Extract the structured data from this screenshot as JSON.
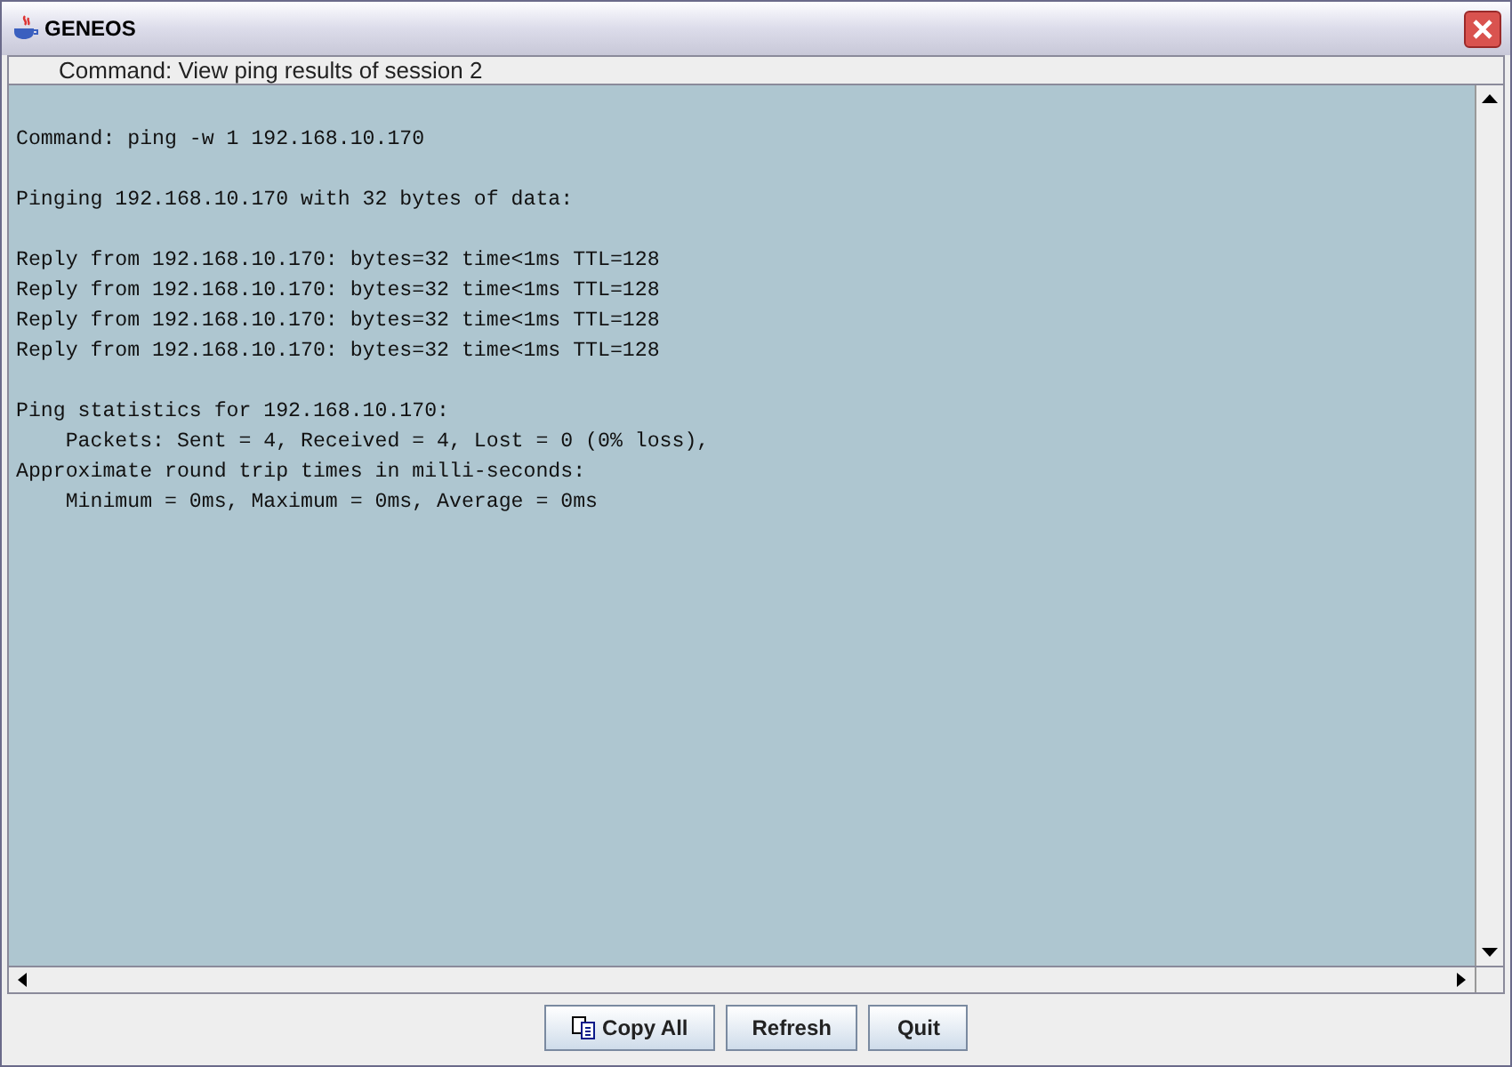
{
  "window": {
    "title": "GENEOS"
  },
  "header": "Command: View ping results of session 2",
  "output": [
    [
      "Command: ping -w 1 192.168.10.170"
    ],
    [
      "Pinging 192.168.10.170 with 32 bytes of data:"
    ],
    [
      "Reply from 192.168.10.170: bytes=32 time<1ms TTL=128",
      "Reply from 192.168.10.170: bytes=32 time<1ms TTL=128",
      "Reply from 192.168.10.170: bytes=32 time<1ms TTL=128",
      "Reply from 192.168.10.170: bytes=32 time<1ms TTL=128"
    ],
    [
      "Ping statistics for 192.168.10.170:",
      "    Packets: Sent = 4, Received = 4, Lost = 0 (0% loss),",
      "Approximate round trip times in milli-seconds:",
      "    Minimum = 0ms, Maximum = 0ms, Average = 0ms"
    ]
  ],
  "buttons": [
    {
      "label": "Copy All",
      "kind": "copy"
    },
    {
      "label": "Refresh",
      "kind": "plain"
    },
    {
      "label": "Quit",
      "kind": "plain"
    }
  ]
}
